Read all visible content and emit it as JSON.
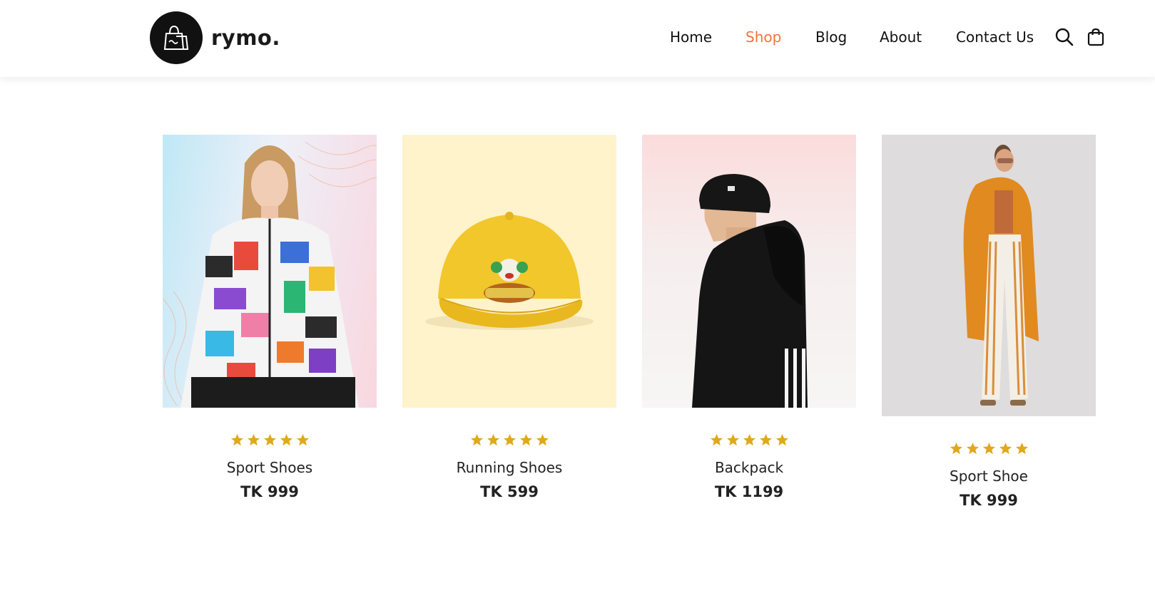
{
  "brand": {
    "name": "rymo."
  },
  "nav": {
    "items": [
      {
        "label": "Home",
        "active": false
      },
      {
        "label": "Shop",
        "active": true
      },
      {
        "label": "Blog",
        "active": false
      },
      {
        "label": "About",
        "active": false
      },
      {
        "label": "Contact Us",
        "active": false
      }
    ],
    "icons": [
      "search-icon",
      "shopping-bag-icon"
    ]
  },
  "colors": {
    "accent": "#f0743e",
    "star": "#e0a81c",
    "text": "#222222"
  },
  "products": [
    {
      "name": "Sport Shoes",
      "price": "TK 999",
      "rating": 5,
      "image": "colorful-print-jacket"
    },
    {
      "name": "Running Shoes",
      "price": "TK 599",
      "rating": 5,
      "image": "yellow-cap"
    },
    {
      "name": "Backpack",
      "price": "TK 1199",
      "rating": 5,
      "image": "black-hoodie-beanie"
    },
    {
      "name": "Sport Shoe",
      "price": "TK 999",
      "rating": 5,
      "image": "orange-coat-striped-pants"
    }
  ]
}
